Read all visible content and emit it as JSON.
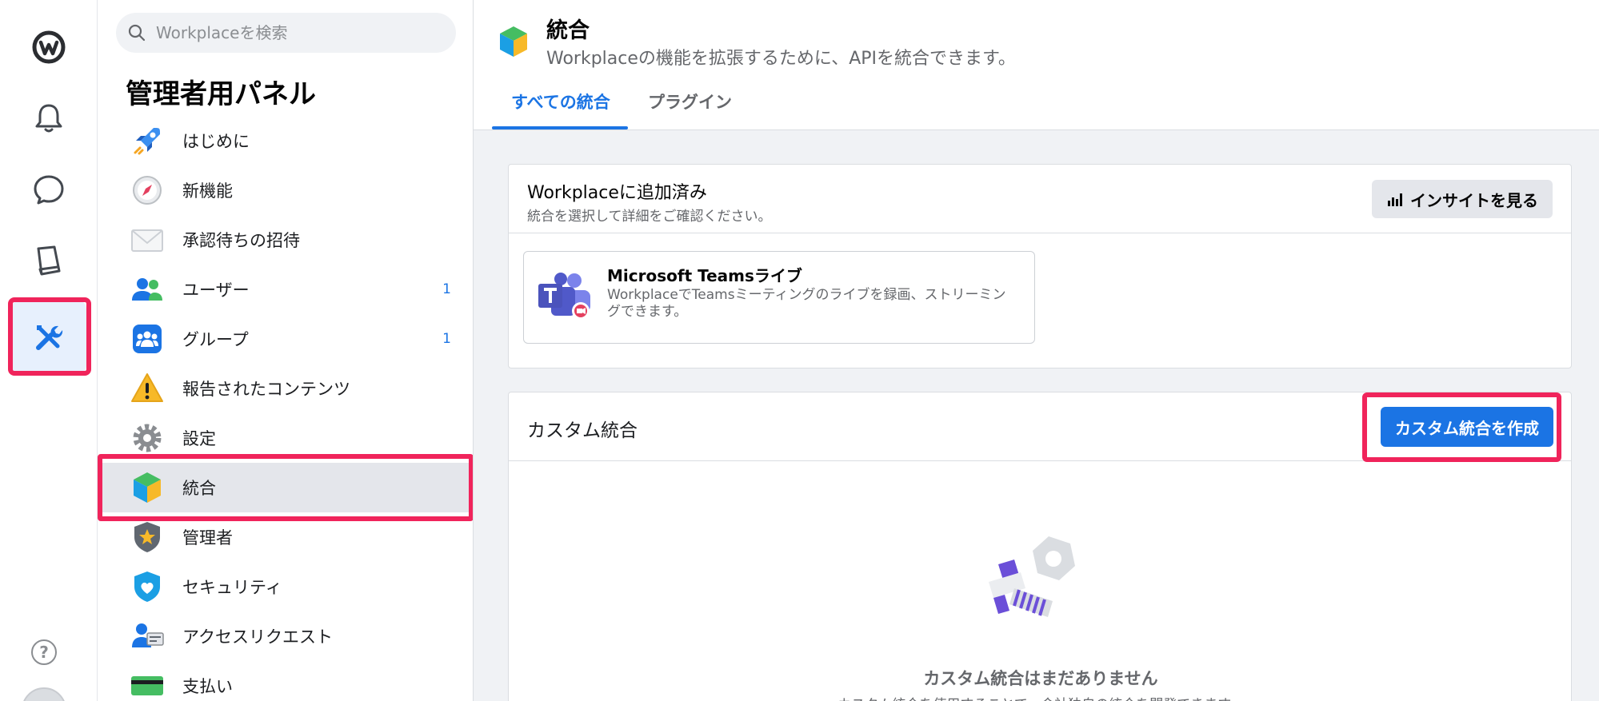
{
  "rail": {
    "help_glyph": "?",
    "icons": [
      "workplace-logo-icon",
      "bell-icon",
      "chat-icon",
      "book-icon",
      "admin-tools-icon"
    ]
  },
  "sidebar": {
    "search_placeholder": "Workplaceを検索",
    "title": "管理者用パネル",
    "items": [
      {
        "label": "はじめに",
        "icon": "rocket-icon",
        "count": ""
      },
      {
        "label": "新機能",
        "icon": "compass-icon",
        "count": ""
      },
      {
        "label": "承認待ちの招待",
        "icon": "envelope-icon",
        "count": ""
      },
      {
        "label": "ユーザー",
        "icon": "users-icon",
        "count": "1"
      },
      {
        "label": "グループ",
        "icon": "group-icon",
        "count": "1"
      },
      {
        "label": "報告されたコンテンツ",
        "icon": "warning-icon",
        "count": ""
      },
      {
        "label": "設定",
        "icon": "gear-icon",
        "count": ""
      },
      {
        "label": "統合",
        "icon": "cube-icon",
        "count": ""
      },
      {
        "label": "管理者",
        "icon": "shield-star-icon",
        "count": ""
      },
      {
        "label": "セキュリティ",
        "icon": "security-shield-icon",
        "count": ""
      },
      {
        "label": "アクセスリクエスト",
        "icon": "access-request-icon",
        "count": ""
      },
      {
        "label": "支払い",
        "icon": "card-icon",
        "count": ""
      }
    ],
    "selected": "統合"
  },
  "header": {
    "title": "統合",
    "subtitle": "Workplaceの機能を拡張するために、APIを統合できます。",
    "tabs": [
      "すべての統合",
      "プラグイン"
    ],
    "active_tab": "すべての統合"
  },
  "added": {
    "title": "Workplaceに追加済み",
    "subtitle": "統合を選択して詳細をご確認ください。",
    "insights_label": "インサイトを見る",
    "integrations": [
      {
        "name": "Microsoft Teamsライブ",
        "description": "WorkplaceでTeamsミーティングのライブを録画、ストリーミングできます。"
      }
    ]
  },
  "custom": {
    "title": "カスタム統合",
    "create_label": "カスタム統合を作成",
    "empty_title": "カスタム統合はまだありません",
    "empty_desc": "カスタム統合を使用することで、会社独自の統合を開発できます。"
  },
  "colors": {
    "accent": "#1b74e4",
    "highlight": "#f0245b"
  }
}
